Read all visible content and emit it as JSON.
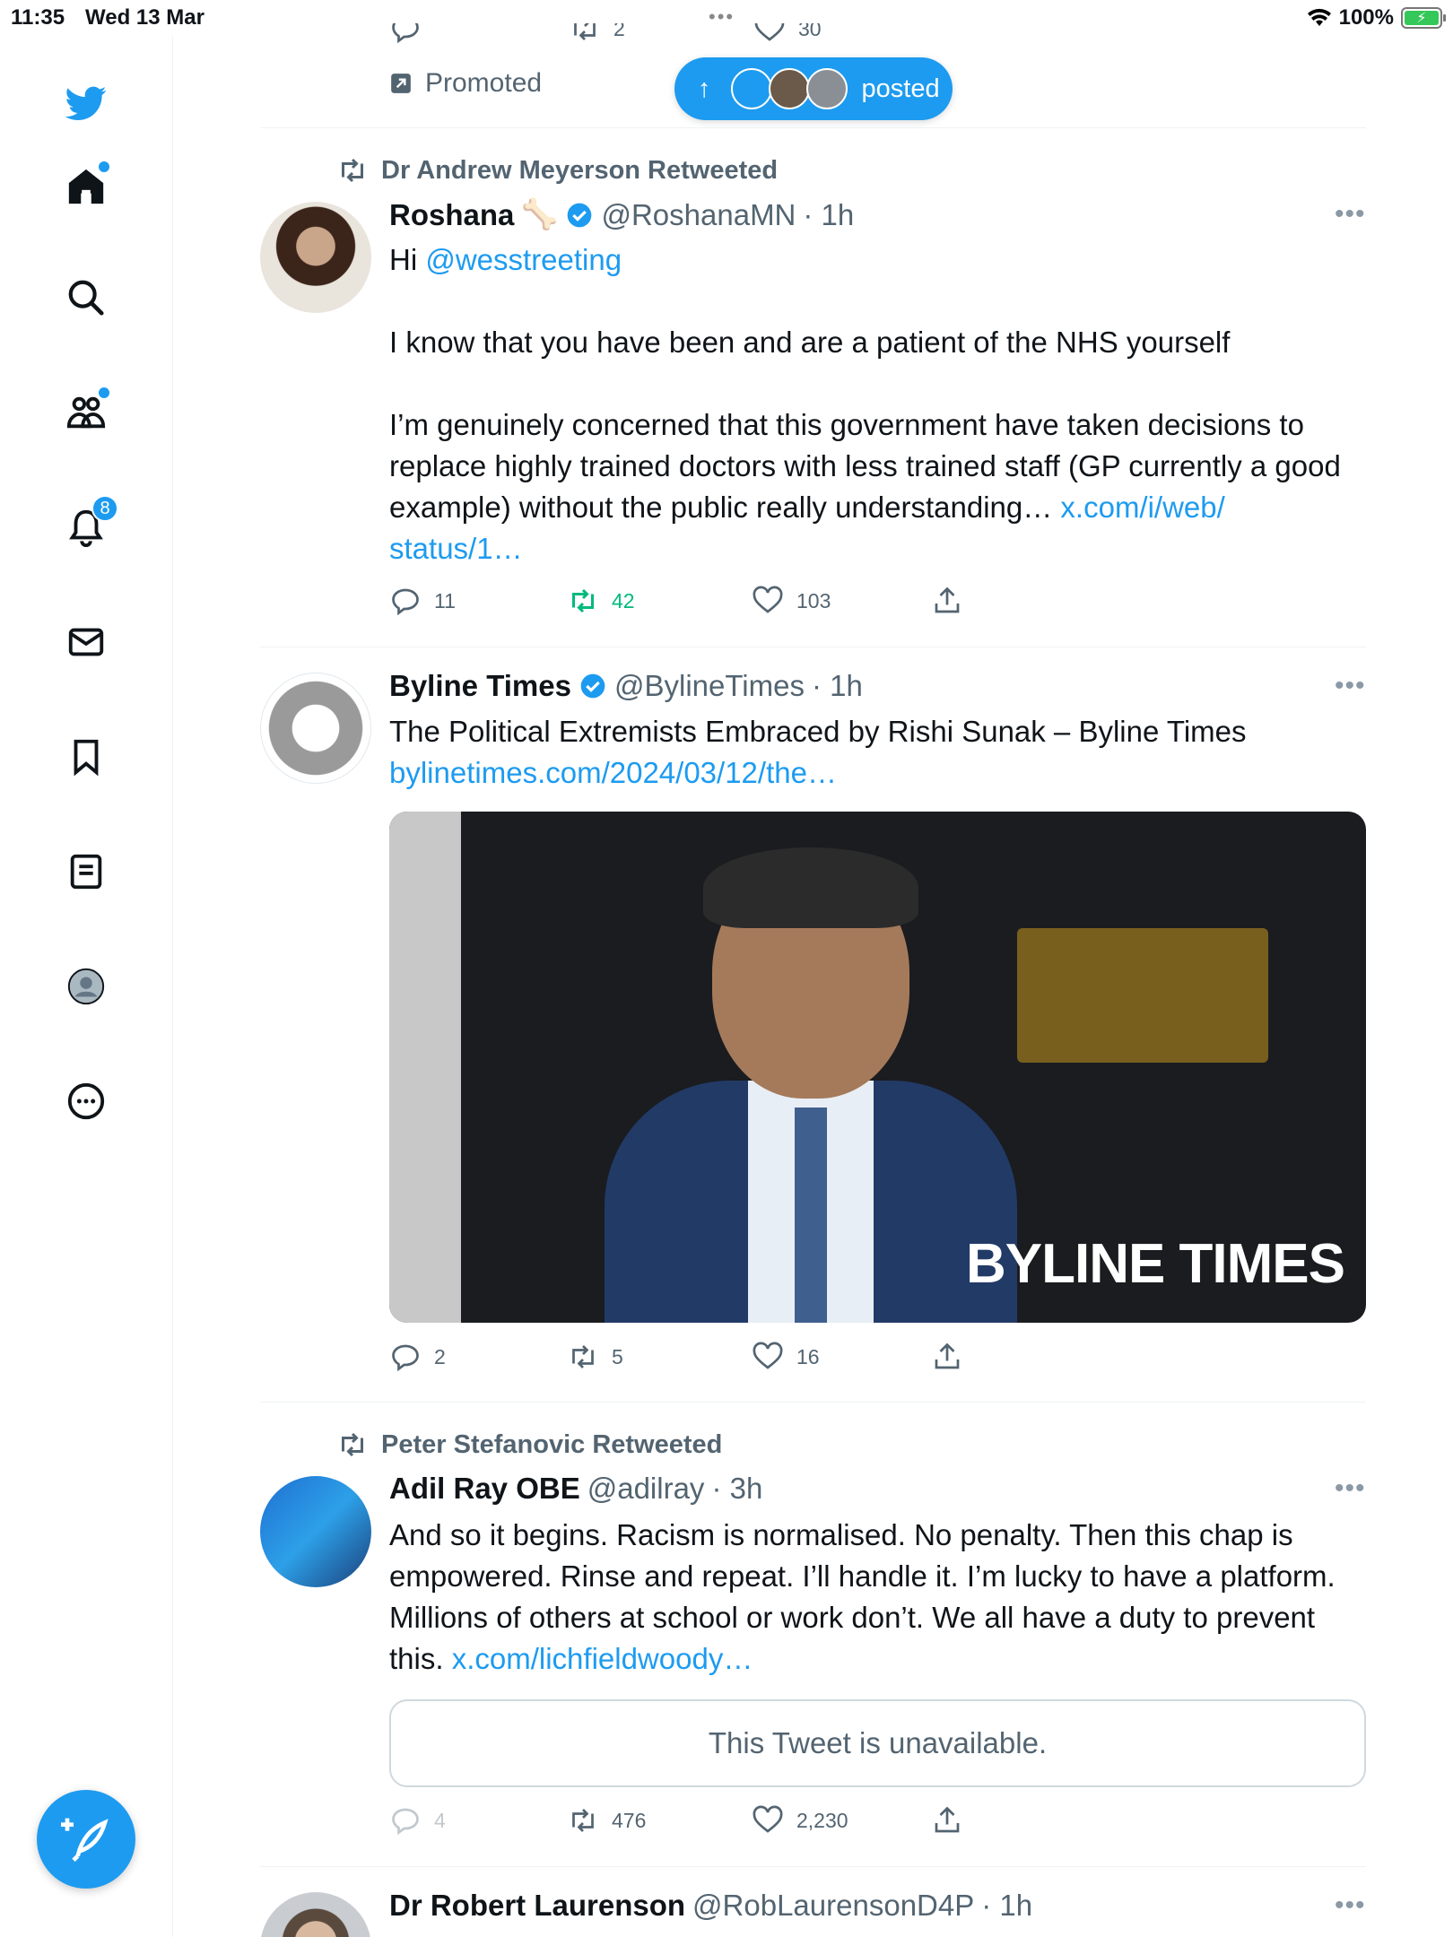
{
  "status_bar": {
    "time": "11:35",
    "date": "Wed 13 Mar",
    "battery": "100%",
    "dots": "•••"
  },
  "sidebar": {
    "notifications_badge": "8"
  },
  "new_posts_pill": {
    "label": "posted",
    "arrow": "↑"
  },
  "promoted": {
    "label": "Promoted",
    "retweets": "2",
    "likes": "30"
  },
  "tweets": [
    {
      "context": "Dr Andrew Meyerson Retweeted",
      "name": "Roshana",
      "emoji": "🦴",
      "handle": "@RoshanaMN",
      "time": "· 1h",
      "text_greeting": "Hi",
      "mention": "@wesstreeting",
      "para1": "I know that you have been and are a patient of the NHS yourself",
      "para2": "I’m genuinely concerned that this government have taken decisions to replace highly trained doctors with less trained staff (GP currently a good example) without the public really understanding…",
      "link_a": "x.com/i/web/",
      "link_b": "status/1…",
      "replies": "11",
      "retweets": "42",
      "likes": "103"
    },
    {
      "name": "Byline Times",
      "handle": "@BylineTimes",
      "time": "· 1h",
      "text": "The Political Extremists Embraced by Rishi Sunak – Byline Times",
      "link": "bylinetimes.com/2024/03/12/the…",
      "media_watermark": "BYLINE TIMES",
      "replies": "2",
      "retweets": "5",
      "likes": "16"
    },
    {
      "context": "Peter Stefanovic Retweeted",
      "name": "Adil Ray OBE",
      "handle": "@adilray",
      "time": "· 3h",
      "text": "And so it begins. Racism is normalised. No penalty. Then this chap is empowered. Rinse and repeat. I’ll handle it. I’m lucky to have a platform. Millions of others at school or work don’t. We all have a duty to prevent this.",
      "link": "x.com/lichfieldwoody…",
      "quote": "This Tweet is unavailable.",
      "replies": "4",
      "retweets": "476",
      "likes": "2,230"
    },
    {
      "name": "Dr Robert Laurenson",
      "handle": "@RobLaurensonD4P",
      "time": "· 1h"
    }
  ],
  "colors": {
    "accent": "#1d9bf0",
    "retweet_active": "#00ba7c",
    "muted": "#536471"
  }
}
